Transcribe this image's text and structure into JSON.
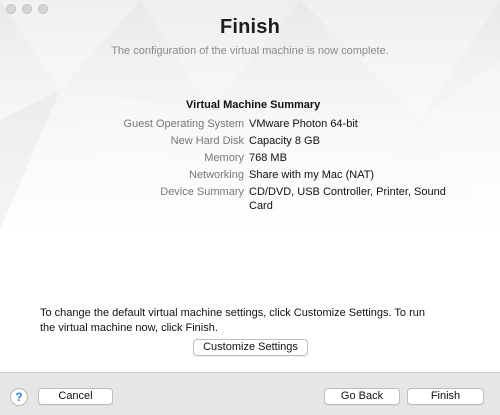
{
  "header": {
    "title": "Finish",
    "subtitle": "The configuration of the virtual machine is now complete."
  },
  "summary": {
    "heading": "Virtual Machine Summary",
    "rows": [
      {
        "key": "Guest Operating System",
        "value": "VMware Photon 64-bit"
      },
      {
        "key": "New Hard Disk",
        "value": "Capacity 8 GB"
      },
      {
        "key": "Memory",
        "value": "768 MB"
      },
      {
        "key": "Networking",
        "value": "Share with my Mac (NAT)"
      },
      {
        "key": "Device Summary",
        "value": "CD/DVD, USB Controller, Printer, Sound Card"
      }
    ]
  },
  "footer": {
    "message": "To change the default virtual machine settings, click Customize Settings. To run the virtual machine now, click Finish.",
    "customize_label": "Customize Settings"
  },
  "bottom_bar": {
    "help_glyph": "?",
    "help_icon": "question-mark-icon",
    "cancel_label": "Cancel",
    "back_label": "Go Back",
    "finish_label": "Finish"
  },
  "colors": {
    "accent": "#2f7df6",
    "window_lights": "#d5d5d5"
  }
}
